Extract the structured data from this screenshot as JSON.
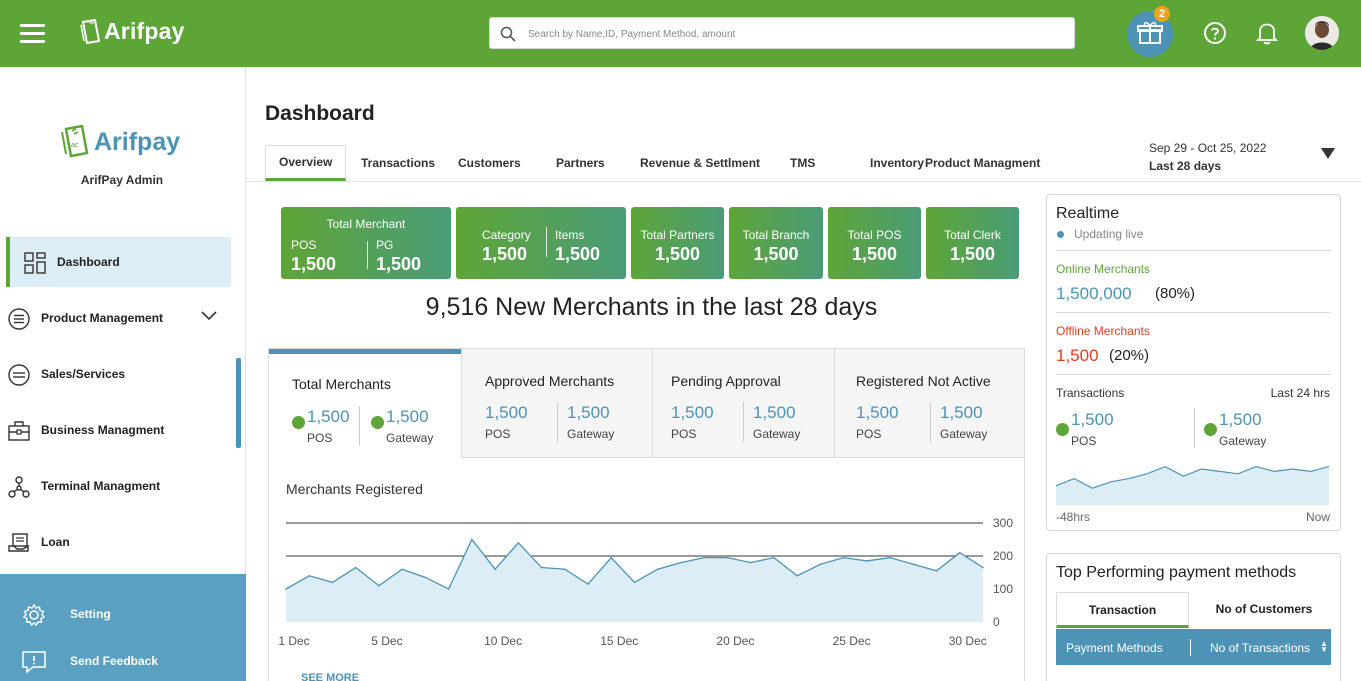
{
  "topbar": {
    "brand": "Arifpay",
    "search_placeholder": "Search by Name,ID, Payment Method, amount",
    "gift_badge": "2"
  },
  "sidebar": {
    "brand": "Arifpay",
    "admin_name": "ArifPay Admin",
    "items": [
      {
        "label": "Dashboard",
        "icon": "grid-icon",
        "active": true
      },
      {
        "label": "Product Management",
        "icon": "list-icon"
      },
      {
        "label": "Sales/Services",
        "icon": "sales-icon"
      },
      {
        "label": "Business Managment",
        "icon": "briefcase-icon"
      },
      {
        "label": "Terminal Managment",
        "icon": "network-icon"
      },
      {
        "label": "Loan",
        "icon": "loan-icon"
      }
    ],
    "bottom": [
      {
        "label": "Setting",
        "icon": "gear-icon"
      },
      {
        "label": "Send Feedback",
        "icon": "feedback-icon"
      }
    ]
  },
  "page": {
    "title": "Dashboard",
    "tabs": [
      "Overview",
      "Transactions",
      "Customers",
      "Partners",
      "Revenue & Settlment",
      "TMS",
      "Inventory",
      "Product Managment"
    ],
    "date_range": "Sep 29 - Oct 25, 2022",
    "date_sub": "Last 28 days"
  },
  "kpis": {
    "merchant": {
      "title": "Total Merchant",
      "a_label": "POS",
      "a_value": "1,500",
      "b_label": "PG",
      "b_value": "1,500"
    },
    "category": {
      "a_label": "Category",
      "a_value": "1,500",
      "b_label": "Items",
      "b_value": "1,500"
    },
    "partners": {
      "title": "Total Partners",
      "value": "1,500"
    },
    "branch": {
      "title": "Total Branch",
      "value": "1,500"
    },
    "pos": {
      "title": "Total POS",
      "value": "1,500"
    },
    "clerk": {
      "title": "Total Clerk",
      "value": "1,500"
    }
  },
  "headline": "9,516 New Merchants in the last 28 days",
  "stat_tabs": [
    {
      "title": "Total Merchants",
      "pos": "1,500",
      "pos_label": "POS",
      "gw": "1,500",
      "gw_label": "Gateway"
    },
    {
      "title": "Approved Merchants",
      "pos": "1,500",
      "pos_label": "POS",
      "gw": "1,500",
      "gw_label": "Gateway"
    },
    {
      "title": "Pending Approval",
      "pos": "1,500",
      "pos_label": "POS",
      "gw": "1,500",
      "gw_label": "Gateway"
    },
    {
      "title": "Registered Not Active",
      "pos": "1,500",
      "pos_label": "POS",
      "gw": "1,500",
      "gw_label": "Gateway"
    }
  ],
  "chart_title": "Merchants Registered",
  "see_more": "SEE MORE",
  "chart_data": [
    {
      "type": "area",
      "title": "Merchants Registered",
      "xlabel": "",
      "ylabel": "",
      "ylim": [
        0,
        300
      ],
      "y_ticks": [
        0,
        100,
        200,
        300
      ],
      "x_ticks": [
        "1 Dec",
        "5 Dec",
        "10 Dec",
        "15 Dec",
        "20 Dec",
        "25 Dec",
        "30 Dec"
      ],
      "x": [
        1,
        2,
        3,
        4,
        5,
        6,
        7,
        8,
        9,
        10,
        11,
        12,
        13,
        14,
        15,
        16,
        17,
        18,
        19,
        20,
        21,
        22,
        23,
        24,
        25,
        26,
        27,
        28,
        29,
        30,
        31
      ],
      "values": [
        100,
        140,
        120,
        165,
        110,
        160,
        135,
        100,
        250,
        160,
        240,
        165,
        160,
        115,
        195,
        120,
        160,
        180,
        195,
        195,
        180,
        195,
        140,
        175,
        195,
        185,
        195,
        175,
        155,
        210,
        165
      ],
      "grid": true
    },
    {
      "type": "area",
      "title": "Transactions",
      "x_ticks": [
        "-48hrs",
        "Now"
      ],
      "values": [
        40,
        55,
        35,
        48,
        55,
        65,
        80,
        60,
        75,
        70,
        65,
        80,
        70,
        75,
        70,
        80
      ],
      "grid": false
    }
  ],
  "realtime": {
    "title": "Realtime",
    "live": "Updating live",
    "online_label": "Online Merchants",
    "online_value": "1,500,000",
    "online_pct": "(80%)",
    "offline_label": "Offline Merchants",
    "offline_value": "1,500",
    "offline_pct": "(20%)",
    "tx_label": "Transactions",
    "tx_range": "Last 24 hrs",
    "pos_value": "1,500",
    "pos_label": "POS",
    "gw_value": "1,500",
    "gw_label": "Gateway",
    "axis_start": "-48hrs",
    "axis_end": "Now"
  },
  "top_payment": {
    "title": "Top Performing payment methods",
    "tabs": [
      "Transaction",
      "No of Customers"
    ],
    "col1": "Payment Methods",
    "col2": "No of Transactions"
  },
  "colors": {
    "brand_green": "#5ea537",
    "accent_blue": "#4c93b6",
    "offline_red": "#e03c1f"
  }
}
